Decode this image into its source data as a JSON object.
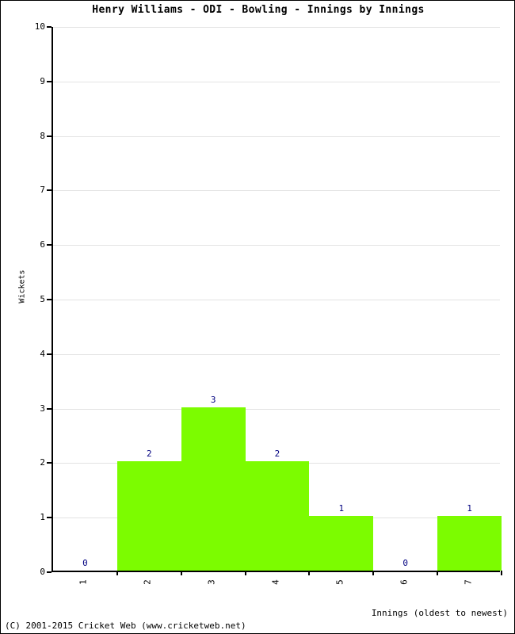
{
  "footer": {
    "copyright": "(C) 2001-2015 Cricket Web (www.cricketweb.net)"
  },
  "colors": {
    "bar": "#7CFC00",
    "value_label": "#000080",
    "gridline": "#E3E3E3",
    "axis": "#000000",
    "background": "#FFFFFF"
  },
  "chart_data": {
    "type": "bar",
    "title": "Henry Williams - ODI - Bowling - Innings by Innings",
    "xlabel": "Innings (oldest to newest)",
    "ylabel": "Wickets",
    "categories": [
      "1",
      "2",
      "3",
      "4",
      "5",
      "6",
      "7"
    ],
    "values": [
      0,
      2,
      3,
      2,
      1,
      0,
      1
    ],
    "value_labels": [
      "0",
      "2",
      "3",
      "2",
      "1",
      "0",
      "1"
    ],
    "ylim": [
      0,
      10
    ],
    "yticks": [
      0,
      1,
      2,
      3,
      4,
      5,
      6,
      7,
      8,
      9,
      10
    ],
    "ytick_labels": [
      "0",
      "1",
      "2",
      "3",
      "4",
      "5",
      "6",
      "7",
      "8",
      "9",
      "10"
    ],
    "grid": true,
    "legend": null,
    "series": [
      {
        "name": "Wickets",
        "values": [
          0,
          2,
          3,
          2,
          1,
          0,
          1
        ]
      }
    ]
  }
}
